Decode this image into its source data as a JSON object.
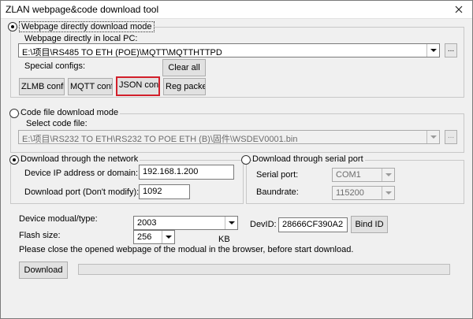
{
  "window": {
    "title": "ZLAN webpage&code download tool"
  },
  "webpage_mode": {
    "label": "Webpage directly download mode",
    "selected": true,
    "local_pc_label": "Webpage directly in local PC:",
    "path_value": "E:\\项目\\RS485 TO ETH (POE)\\MQTT\\MQTTHTTPD",
    "browse_label": "...",
    "special_configs_label": "Special configs:",
    "clear_all_label": "Clear all",
    "buttons": [
      "ZLMB config",
      "MQTT config",
      "JSON config",
      "Reg packet"
    ]
  },
  "code_mode": {
    "label": "Code file download mode",
    "selected": false,
    "select_label": "Select code file:",
    "path_value": "E:\\项目\\RS232 TO ETH\\RS232 TO POE ETH (B)\\固件\\WSDEV0001.bin",
    "browse_label": "..."
  },
  "network": {
    "label": "Download through the network",
    "selected": true,
    "ip_label": "Device IP address or domain:",
    "ip_value": "192.168.1.200",
    "port_label": "Download port (Don't modify):",
    "port_value": "1092"
  },
  "serial": {
    "label": "Download through serial port",
    "selected": false,
    "port_label": "Serial port:",
    "port_value": "COM1",
    "baud_label": "Baundrate:",
    "baud_value": "115200"
  },
  "device": {
    "type_label": "Device modual/type:",
    "type_value": "2003",
    "devid_label": "DevID:",
    "devid_value": "28666CF390A2",
    "bind_label": "Bind ID",
    "flash_label": "Flash size:",
    "flash_value": "256",
    "flash_unit": "KB",
    "notice": "Please close the opened webpage of the modual in the browser, before start download.",
    "download_label": "Download",
    "progress": 0
  },
  "colors": {
    "highlight_border": "#d21f2a",
    "progress_fill": "#06b025"
  }
}
